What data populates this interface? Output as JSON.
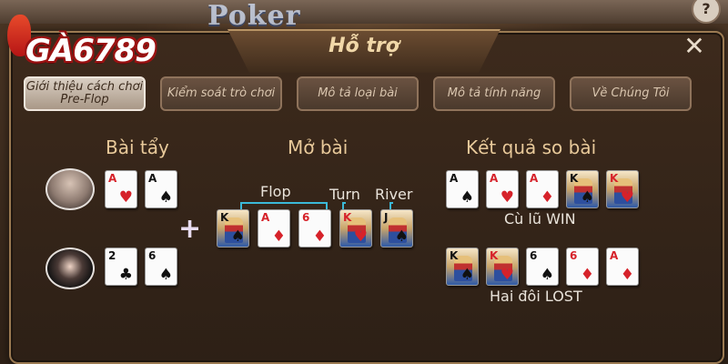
{
  "logo": {
    "text": "GÀ6789"
  },
  "background": {
    "game_title": "Poker",
    "help_icon": "?"
  },
  "dialog": {
    "title": "Hỗ trợ",
    "close_icon": "✕",
    "tabs": [
      {
        "label": "Giới thiệu cách chơi Pre-Flop",
        "active": true
      },
      {
        "label": "Kiểm soát trò chơi",
        "active": false
      },
      {
        "label": "Mô tả loại bài",
        "active": false
      },
      {
        "label": "Mô tả tính năng",
        "active": false
      },
      {
        "label": "Về Chúng Tôi",
        "active": false
      }
    ]
  },
  "sections": {
    "hole_cards": "Bài tẩy",
    "community": "Mở bài",
    "result": "Kết quả so bài"
  },
  "players": [
    {
      "hand": [
        {
          "rank": "A",
          "suit": "♥",
          "color": "red"
        },
        {
          "rank": "A",
          "suit": "♠",
          "color": "blk"
        }
      ]
    },
    {
      "hand": [
        {
          "rank": "2",
          "suit": "♣",
          "color": "blk"
        },
        {
          "rank": "6",
          "suit": "♠",
          "color": "blk"
        }
      ]
    }
  ],
  "community_cards": [
    {
      "rank": "K",
      "suit": "♠",
      "color": "blk",
      "face": true
    },
    {
      "rank": "A",
      "suit": "♦",
      "color": "red"
    },
    {
      "rank": "6",
      "suit": "♦",
      "color": "red"
    },
    {
      "rank": "K",
      "suit": "♥",
      "color": "red",
      "face": true
    },
    {
      "rank": "J",
      "suit": "♠",
      "color": "blk",
      "face": true
    }
  ],
  "stage_labels": {
    "flop": "Flop",
    "turn": "Turn",
    "river": "River"
  },
  "results": [
    {
      "cards": [
        {
          "rank": "A",
          "suit": "♠",
          "color": "blk"
        },
        {
          "rank": "A",
          "suit": "♥",
          "color": "red"
        },
        {
          "rank": "A",
          "suit": "♦",
          "color": "red"
        },
        {
          "rank": "K",
          "suit": "♠",
          "color": "blk",
          "face": true
        },
        {
          "rank": "K",
          "suit": "♥",
          "color": "red",
          "face": true
        }
      ],
      "text": "Cù lũ WIN"
    },
    {
      "cards": [
        {
          "rank": "K",
          "suit": "♠",
          "color": "blk",
          "face": true
        },
        {
          "rank": "K",
          "suit": "♥",
          "color": "red",
          "face": true
        },
        {
          "rank": "6",
          "suit": "♠",
          "color": "blk"
        },
        {
          "rank": "6",
          "suit": "♦",
          "color": "red"
        },
        {
          "rank": "A",
          "suit": "♦",
          "color": "red"
        }
      ],
      "text": "Hai đôi LOST"
    }
  ]
}
